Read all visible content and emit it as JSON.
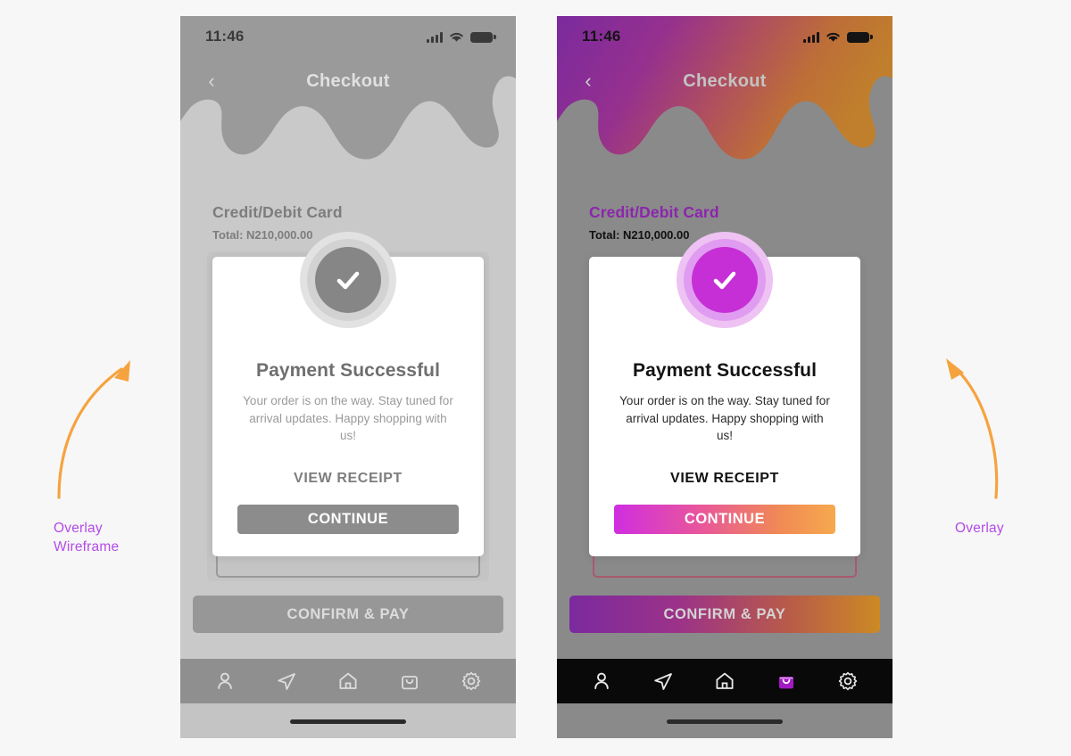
{
  "canvas": {
    "background": "#f7f7f7"
  },
  "accent": {
    "purple": "#8c25ad",
    "magenta": "#c62ed6",
    "orange": "#f5a33f",
    "annotation_purple": "#b44be8",
    "gradient_start": "#7b2a9e",
    "gradient_end": "#cc8a24"
  },
  "screens": [
    {
      "id": "wireframe",
      "variant": "Overlay Wireframe",
      "status_bar": {
        "time": "11:46",
        "signal_icon": "cellular-signal-icon",
        "wifi_icon": "wifi-icon",
        "battery_icon": "battery-icon"
      },
      "nav": {
        "back_icon": "chevron-left-icon",
        "title": "Checkout"
      },
      "content": {
        "section_title": "Credit/Debit Card",
        "total": "Total: N210,000.00"
      },
      "modal": {
        "status_icon": "check-circle-icon",
        "title": "Payment Successful",
        "message": "Your order is on the way. Stay tuned for arrival updates. Happy shopping with us!",
        "receipt_link": "VIEW RECEIPT",
        "primary_button": "CONTINUE"
      },
      "confirm_button": "CONFIRM & PAY",
      "tabbar": [
        {
          "name": "profile",
          "icon": "person-icon",
          "active": false
        },
        {
          "name": "send",
          "icon": "paper-plane-icon",
          "active": false
        },
        {
          "name": "home",
          "icon": "home-icon",
          "active": false
        },
        {
          "name": "bag",
          "icon": "shopping-bag-icon",
          "active": false
        },
        {
          "name": "settings",
          "icon": "gear-icon",
          "active": false
        }
      ]
    },
    {
      "id": "overlay",
      "variant": "Overlay",
      "status_bar": {
        "time": "11:46",
        "signal_icon": "cellular-signal-icon",
        "wifi_icon": "wifi-icon",
        "battery_icon": "battery-icon"
      },
      "nav": {
        "back_icon": "chevron-left-icon",
        "title": "Checkout"
      },
      "content": {
        "section_title": "Credit/Debit Card",
        "total": "Total: N210,000.00"
      },
      "modal": {
        "status_icon": "check-circle-icon",
        "title": "Payment Successful",
        "message": "Your order is on the way. Stay tuned for arrival updates. Happy shopping with us!",
        "receipt_link": "VIEW RECEIPT",
        "primary_button": "CONTINUE"
      },
      "confirm_button": "CONFIRM & PAY",
      "tabbar": [
        {
          "name": "profile",
          "icon": "person-icon",
          "active": false
        },
        {
          "name": "send",
          "icon": "paper-plane-icon",
          "active": false
        },
        {
          "name": "home",
          "icon": "home-icon",
          "active": false
        },
        {
          "name": "bag",
          "icon": "shopping-bag-icon",
          "active": true
        },
        {
          "name": "settings",
          "icon": "gear-icon",
          "active": false
        }
      ]
    }
  ],
  "annotations": {
    "left": {
      "line1": "Overlay",
      "line2": "Wireframe",
      "arrow_icon": "curved-arrow-up-right-icon"
    },
    "right": {
      "line1": "Overlay",
      "line2": "",
      "arrow_icon": "curved-arrow-up-left-icon"
    }
  }
}
